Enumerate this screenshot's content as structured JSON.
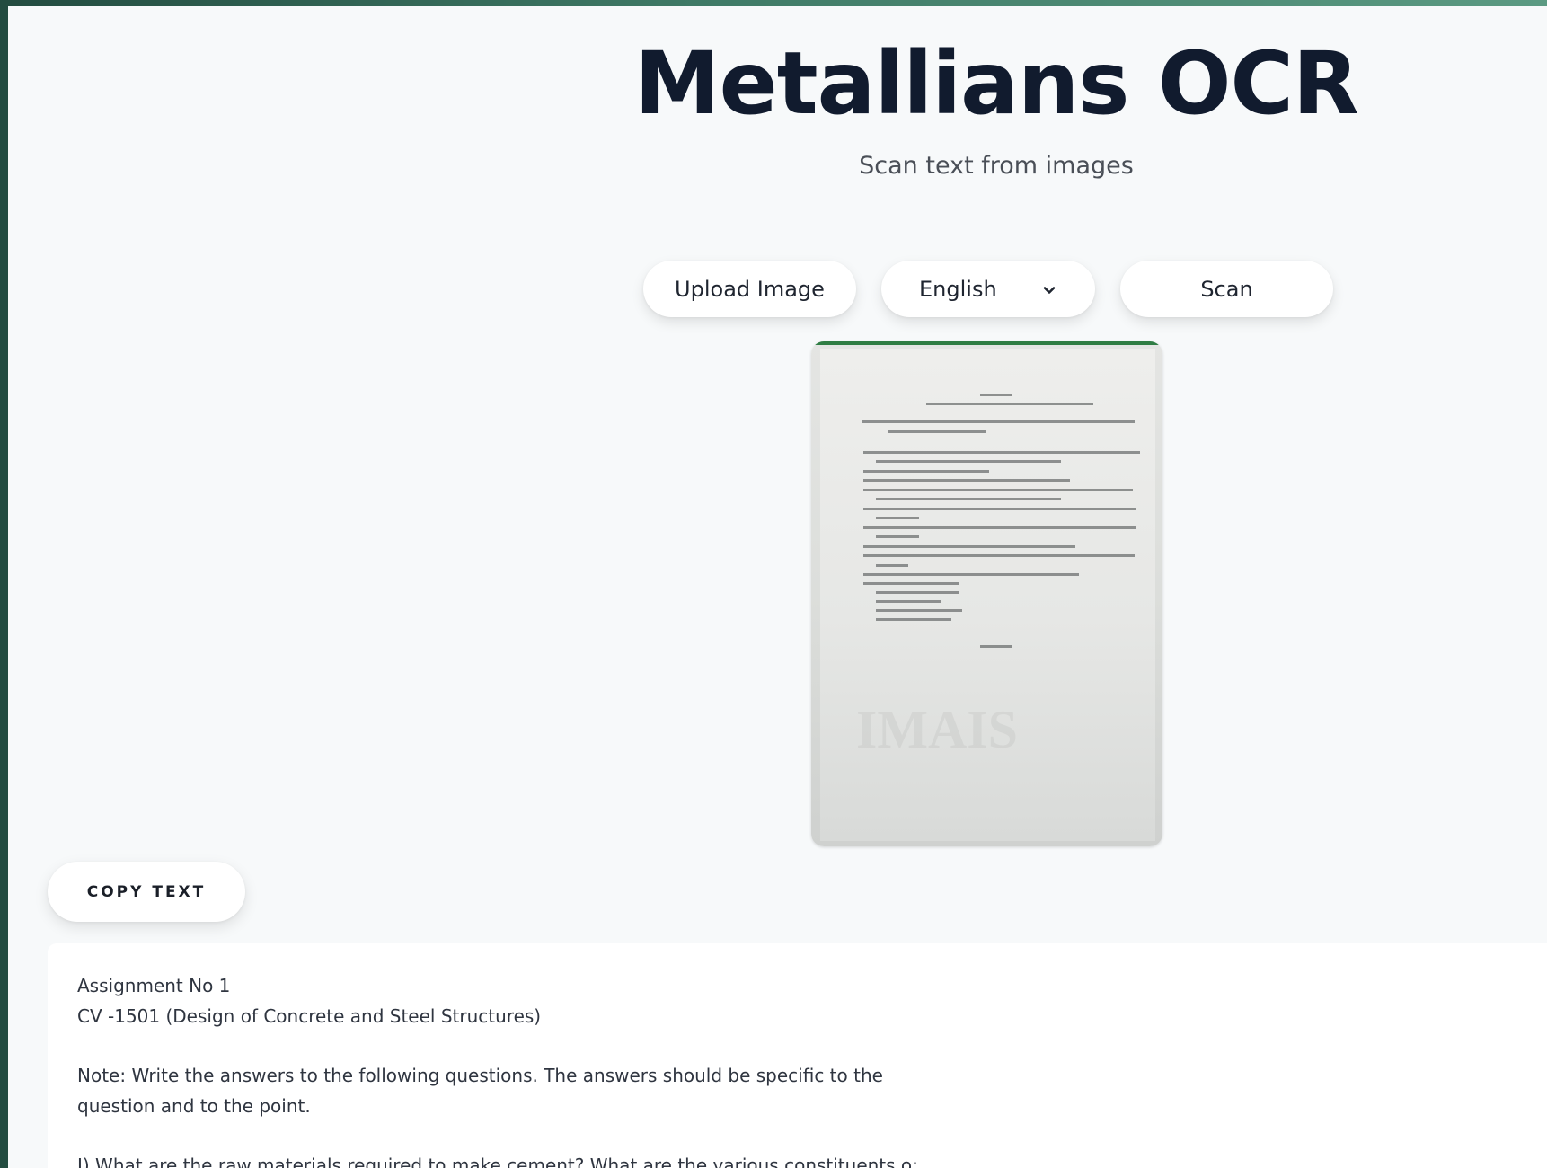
{
  "header": {
    "title": "Metallians OCR",
    "subtitle": "Scan text from images"
  },
  "toolbar": {
    "upload_label": "Upload Image",
    "language": {
      "selected": "English",
      "icon": "chevron-down-icon"
    },
    "scan_label": "Scan"
  },
  "colors": {
    "page_background": "#f7f9fa",
    "frame_gradient_start": "#234c40",
    "frame_gradient_end": "#5b9a82",
    "title_color": "#111b2e"
  },
  "copy_button": {
    "label": "COPY TEXT"
  },
  "result": {
    "lines": [
      "Assignment No 1",
      "CV -1501 (Design of Concrete and Steel Structures)",
      "Note: Write the answers to the following questions. The answers should be specific to the question and to the point.",
      "I) What are the raw materials required to make cement? What are the various constituents o:"
    ]
  }
}
